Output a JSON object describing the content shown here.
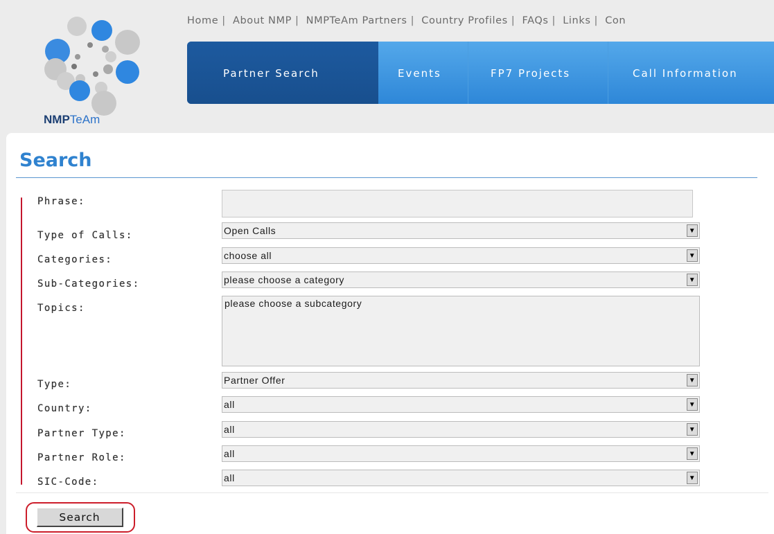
{
  "header": {
    "logo_text_prefix": "NMP",
    "logo_text_suffix": "TeAm",
    "top_links": [
      "Home",
      "About NMP",
      "NMPTeAm Partners",
      "Country Profiles",
      "FAQs",
      "Links",
      "Con"
    ],
    "nav_tabs": [
      "Partner Search",
      "Events",
      "FP7 Projects",
      "Call Information"
    ]
  },
  "form": {
    "title": "Search",
    "phrase_label": "Phrase:",
    "phrase_value": "",
    "type_of_calls_label": "Type of Calls:",
    "type_of_calls_value": "Open Calls",
    "categories_label": "Categories:",
    "categories_value": "choose all",
    "subcategories_label": "Sub-Categories:",
    "subcategories_value": "please choose a category",
    "topics_label": "Topics:",
    "topics_value": "please choose a subcategory",
    "type_label": "Type:",
    "type_value": "Partner Offer",
    "country_label": "Country:",
    "country_value": "all",
    "partner_type_label": "Partner Type:",
    "partner_type_value": "all",
    "partner_role_label": "Partner Role:",
    "partner_role_value": "all",
    "sic_code_label": "SIC-Code:",
    "sic_code_value": "all",
    "search_button_label": "Search"
  },
  "colors": {
    "accent_blue": "#2f82cf",
    "nav_active": "#1d5a9f",
    "highlight_red": "#cc1d2a"
  },
  "icons": {
    "dropdown": "triangle-down-icon",
    "logo": "bubbles-logo-icon"
  }
}
